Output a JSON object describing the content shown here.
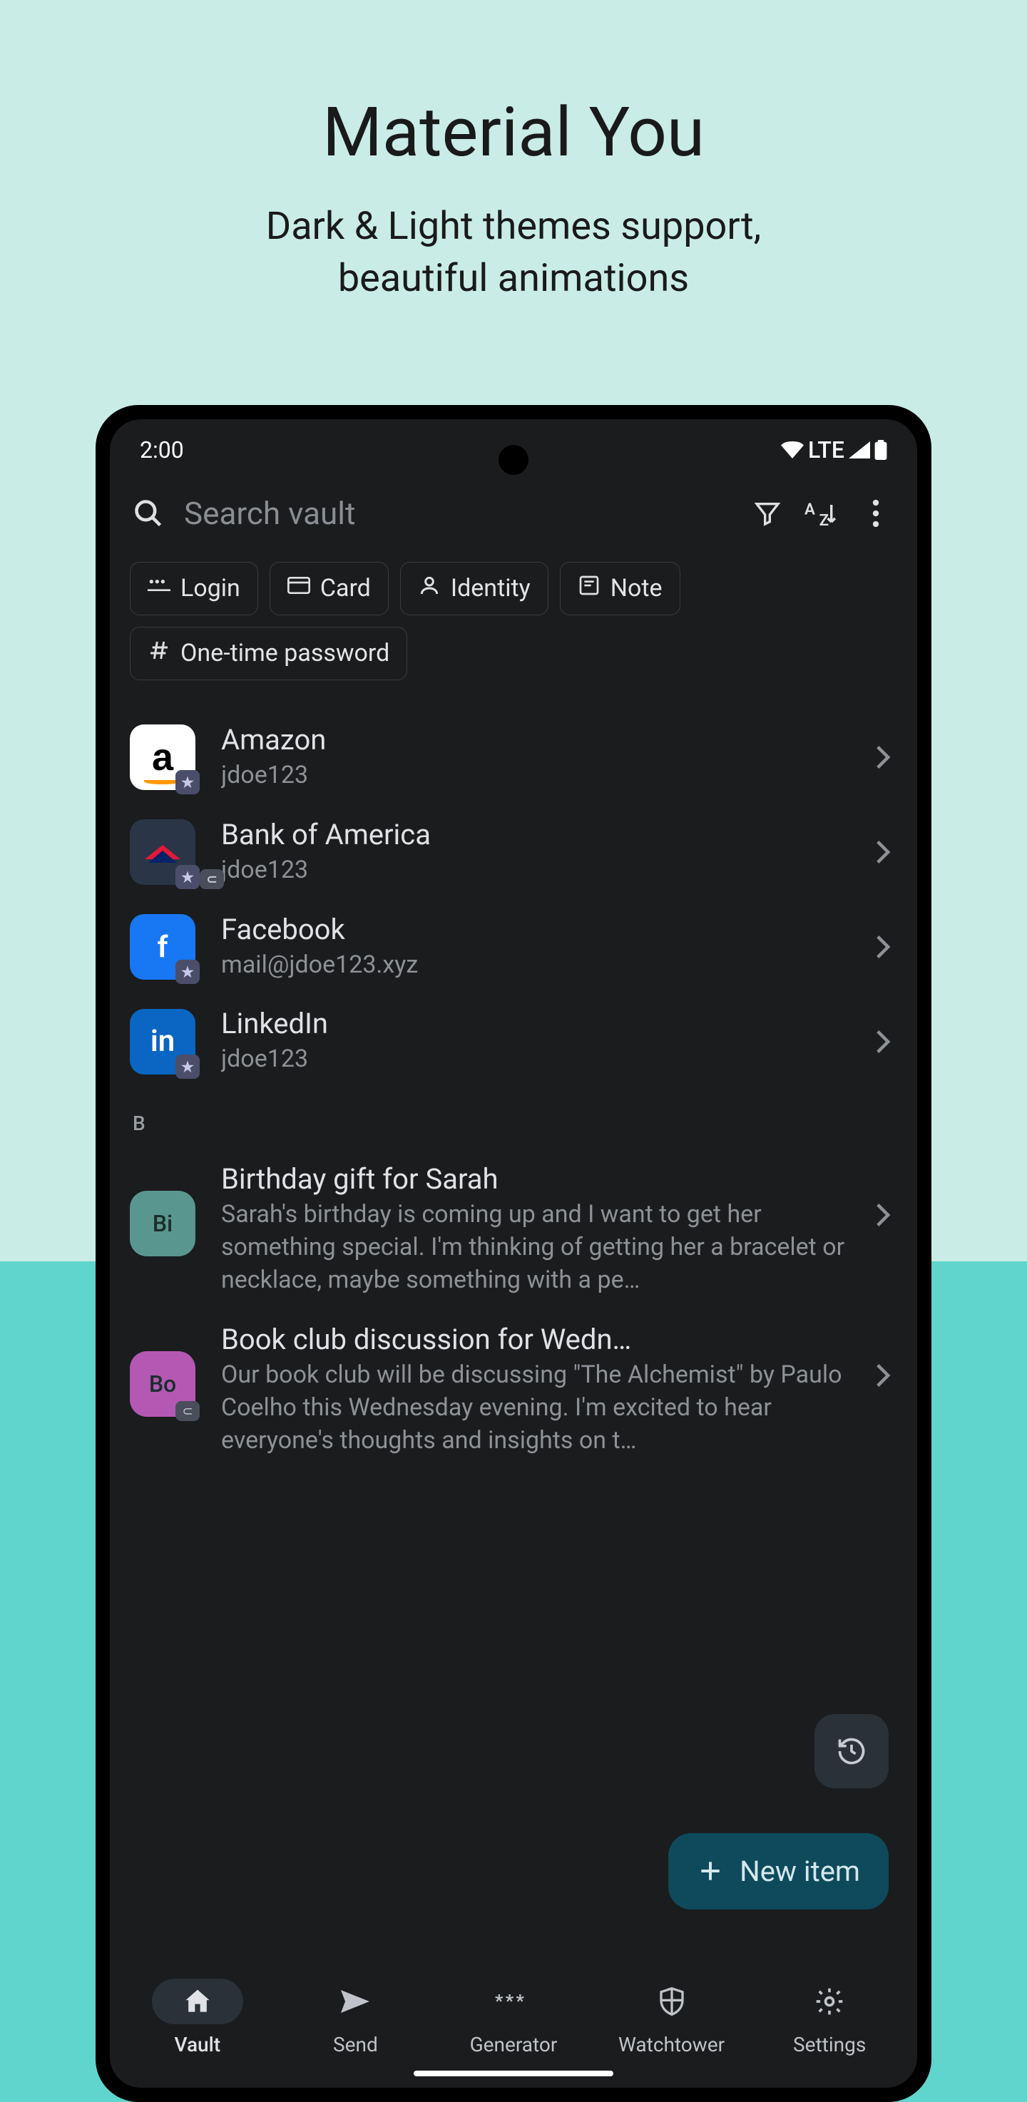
{
  "hero": {
    "title": "Material You",
    "subtitle_line1": "Dark & Light themes support,",
    "subtitle_line2": "beautiful animations"
  },
  "status": {
    "time": "2:00",
    "network": "LTE"
  },
  "search": {
    "placeholder": "Search vault"
  },
  "chips": [
    {
      "label": "Login",
      "icon": "password"
    },
    {
      "label": "Card",
      "icon": "card"
    },
    {
      "label": "Identity",
      "icon": "person"
    },
    {
      "label": "Note",
      "icon": "note"
    },
    {
      "label": "One-time password",
      "icon": "hash"
    }
  ],
  "items": [
    {
      "title": "Amazon",
      "subtitle": "jdoe123",
      "icon_bg": "#fff",
      "icon_letter": "a",
      "icon_color": "#000",
      "badge": "star"
    },
    {
      "title": "Bank of America",
      "subtitle": "jdoe123",
      "icon_bg": "#2a3548",
      "icon_letter": "",
      "badge": "star_attach"
    },
    {
      "title": "Facebook",
      "subtitle": "mail@jdoe123.xyz",
      "icon_bg": "#1877f2",
      "icon_letter": "f",
      "icon_color": "#fff",
      "badge": "star"
    },
    {
      "title": "LinkedIn",
      "subtitle": "jdoe123",
      "icon_bg": "#0a66c2",
      "icon_letter": "in",
      "icon_color": "#fff",
      "badge": "star"
    }
  ],
  "section_b": "B",
  "notes": [
    {
      "title": "Birthday gift for Sarah",
      "body": "Sarah's birthday is coming up and I want to get her something special. I'm thinking of getting her a bracelet or necklace, maybe something with a pe…",
      "icon_label": "Bi",
      "icon_bg": "#5a9690"
    },
    {
      "title": "Book club discussion for Wedn…",
      "body": "Our book club will be discussing \"The Alchemist\" by Paulo Coelho this Wednesday evening. I'm excited to hear everyone's thoughts and insights on t…",
      "icon_label": "Bo",
      "icon_bg": "#b458b4",
      "badge": "attach"
    }
  ],
  "fab": {
    "label": "New item"
  },
  "nav": [
    {
      "label": "Vault",
      "icon": "home",
      "active": true
    },
    {
      "label": "Send",
      "icon": "send"
    },
    {
      "label": "Generator",
      "icon": "dots"
    },
    {
      "label": "Watchtower",
      "icon": "shield"
    },
    {
      "label": "Settings",
      "icon": "gear"
    }
  ]
}
